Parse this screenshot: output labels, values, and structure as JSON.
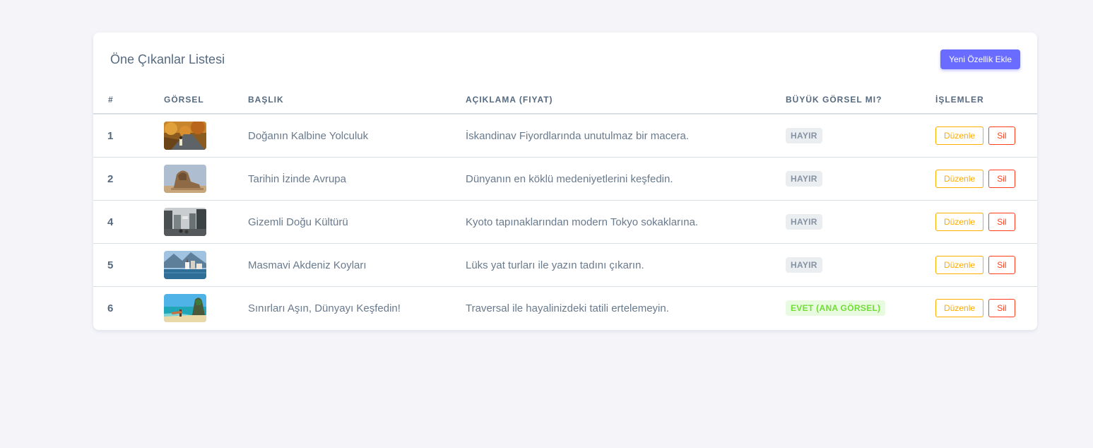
{
  "card": {
    "title": "Öne Çıkanlar Listesi",
    "add_button_label": "Yeni Özellik Ekle"
  },
  "table": {
    "headers": [
      "#",
      "GÖRSEL",
      "BAŞLIK",
      "AÇIKLAMA (FIYAT)",
      "BÜYÜK GÖRSEL MI?",
      "İŞLEMLER"
    ],
    "rows": [
      {
        "id": "1",
        "title": "Doğanın Kalbine Yolculuk",
        "description": "İskandinav Fiyordlarında unutulmaz bir macera.",
        "big": "HAYIR",
        "edit": "Düzenle",
        "delete": "Sil",
        "image": "autumn-road-photo"
      },
      {
        "id": "2",
        "title": "Tarihin İzinde Avrupa",
        "description": "Dünyanın en köklü medeniyetlerini keşfedin.",
        "big": "HAYIR",
        "edit": "Düzenle",
        "delete": "Sil",
        "image": "sphinx-photo"
      },
      {
        "id": "4",
        "title": "Gizemli Doğu Kültürü",
        "description": "Kyoto tapınaklarından modern Tokyo sokaklarına.",
        "big": "HAYIR",
        "edit": "Düzenle",
        "delete": "Sil",
        "image": "city-street-photo"
      },
      {
        "id": "5",
        "title": "Masmavi Akdeniz Koyları",
        "description": "Lüks yat turları ile yazın tadını çıkarın.",
        "big": "HAYIR",
        "edit": "Düzenle",
        "delete": "Sil",
        "image": "lakeside-town-photo"
      },
      {
        "id": "6",
        "title": "Sınırları Aşın, Dünyayı Keşfedin!",
        "description": "Traversal ile hayalinizdeki tatili ertelemeyin.",
        "big": "EVET (ANA GÖRSEL)",
        "edit": "Düzenle",
        "delete": "Sil",
        "image": "tropical-beach-photo"
      }
    ]
  },
  "colors": {
    "accent": "#696cff",
    "edit": "#ffab00",
    "delete": "#ff3e1d",
    "badge_no_bg": "#ebeef0",
    "badge_yes_bg": "#e8fadf",
    "badge_yes_text": "#71dd37"
  }
}
